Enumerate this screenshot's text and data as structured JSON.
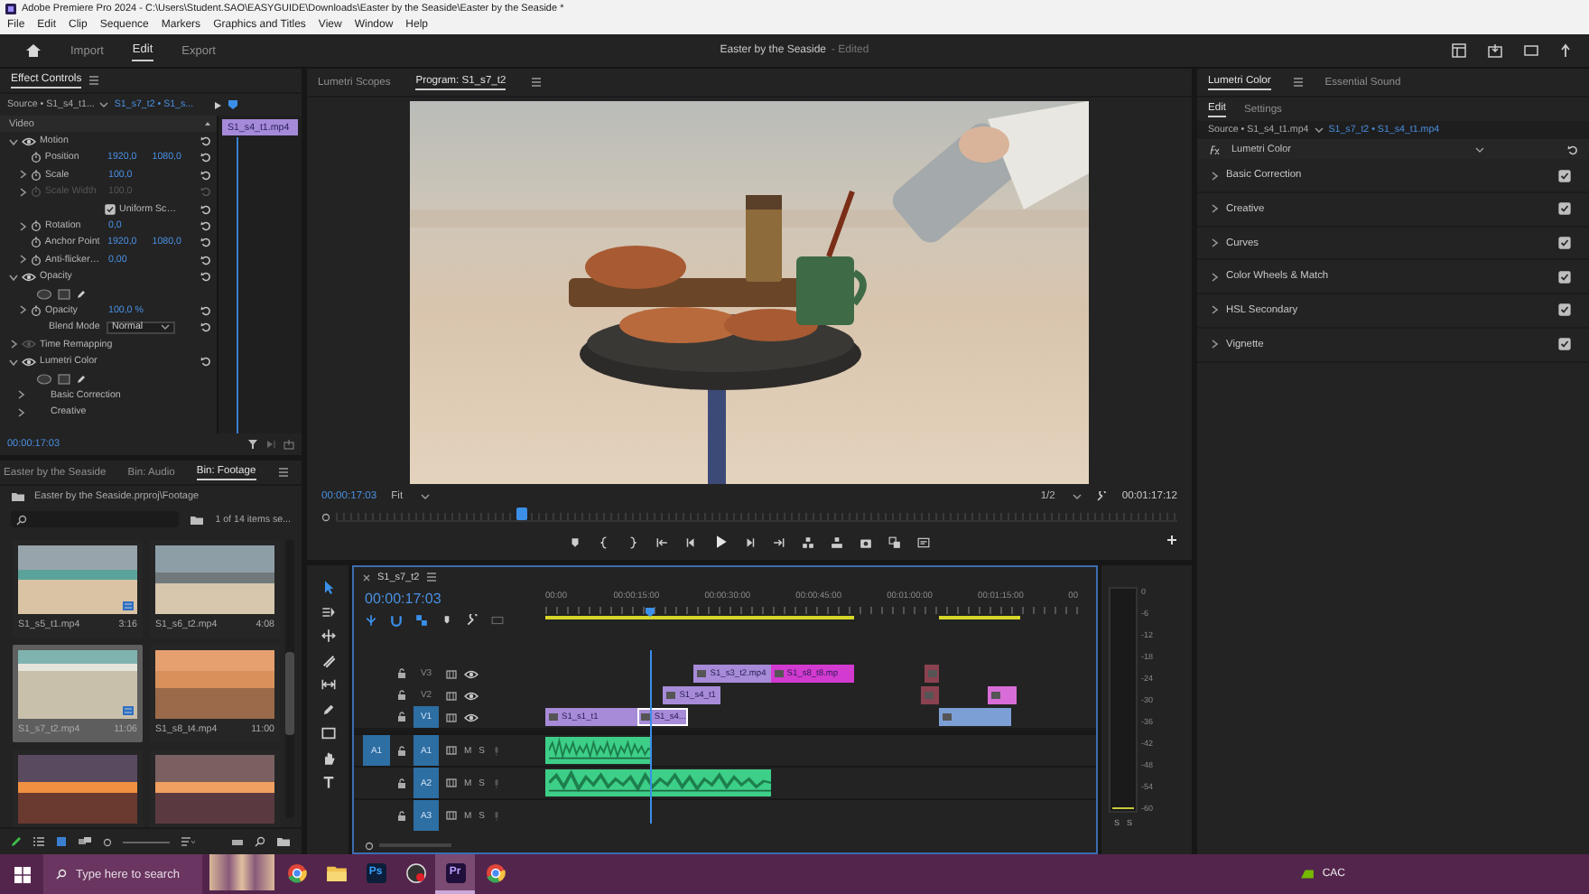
{
  "window": {
    "title": "Adobe Premiere Pro 2024 - C:\\Users\\Student.SAO\\EASYGUIDE\\Downloads\\Easter by the Seaside\\Easter by the Seaside *"
  },
  "menu": [
    "File",
    "Edit",
    "Clip",
    "Sequence",
    "Markers",
    "Graphics and Titles",
    "View",
    "Window",
    "Help"
  ],
  "workspace_tabs": [
    {
      "label": "Import",
      "selected": false
    },
    {
      "label": "Edit",
      "selected": true
    },
    {
      "label": "Export",
      "selected": false
    }
  ],
  "document": {
    "title": "Easter by the Seaside",
    "status": "- Edited"
  },
  "effect_controls": {
    "tab": "Effect Controls",
    "source": "Source • S1_s4_t1...",
    "target": "S1_s7_t2 • S1_s...",
    "clip": "S1_s4_t1.mp4",
    "section": "Video",
    "timecode": "00:00:17:03",
    "rows": [
      {
        "kind": "group",
        "label": "Motion",
        "expanded": true
      },
      {
        "kind": "param",
        "label": "Position",
        "values": [
          "1920,0",
          "1080,0"
        ],
        "expandable": false,
        "disabled": false
      },
      {
        "kind": "param",
        "label": "Scale",
        "values": [
          "100,0"
        ],
        "expandable": true,
        "disabled": false
      },
      {
        "kind": "param",
        "label": "Scale Width",
        "values": [
          "100,0"
        ],
        "expandable": true,
        "disabled": true
      },
      {
        "kind": "check",
        "label": "Uniform Sc…",
        "checked": true
      },
      {
        "kind": "param",
        "label": "Rotation",
        "values": [
          "0,0"
        ],
        "expandable": true,
        "disabled": false
      },
      {
        "kind": "param",
        "label": "Anchor Point",
        "values": [
          "1920,0",
          "1080,0"
        ],
        "expandable": false,
        "disabled": false
      },
      {
        "kind": "param",
        "label": "Anti-flicker…",
        "values": [
          "0,00"
        ],
        "expandable": true,
        "disabled": false
      },
      {
        "kind": "group",
        "label": "Opacity",
        "expanded": true
      },
      {
        "kind": "masks"
      },
      {
        "kind": "param",
        "label": "Opacity",
        "values": [
          "100,0 %"
        ],
        "expandable": true,
        "disabled": false
      },
      {
        "kind": "dropdown",
        "label": "Blend Mode",
        "value": "Normal"
      },
      {
        "kind": "group",
        "label": "Time Remapping",
        "expanded": false
      },
      {
        "kind": "group",
        "label": "Lumetri Color",
        "expanded": true
      },
      {
        "kind": "masks"
      },
      {
        "kind": "sub",
        "label": "Basic Correction"
      },
      {
        "kind": "sub",
        "label": "Creative"
      }
    ]
  },
  "program": {
    "tabs": [
      {
        "label": "Lumetri Scopes",
        "selected": false
      },
      {
        "label": "Program: S1_s7_t2",
        "selected": true
      }
    ],
    "timecode": "00:00:17:03",
    "zoom": "Fit",
    "resolution": "1/2",
    "duration": "00:01:17:12",
    "playhead": {
      "level": 0.22
    }
  },
  "project": {
    "tabs": [
      {
        "label": "Easter by the Seaside",
        "selected": false
      },
      {
        "label": "Bin: Audio",
        "selected": false
      },
      {
        "label": "Bin: Footage",
        "selected": true
      }
    ],
    "path": "Easter by the Seaside.prproj\\Footage",
    "count": "1 of 14 items se...",
    "items": [
      {
        "label": "S1_s5_t1.mp4",
        "duration": "3:16",
        "selected": false,
        "badge": true
      },
      {
        "label": "S1_s6_t2.mp4",
        "duration": "4:08",
        "selected": false,
        "badge": false
      },
      {
        "label": "S1_s7_t2.mp4",
        "duration": "11:06",
        "selected": true,
        "badge": true
      },
      {
        "label": "S1_s8_t4.mp4",
        "duration": "11:00",
        "selected": false,
        "badge": false
      },
      {
        "selected": false,
        "badge": false
      },
      {
        "selected": false,
        "badge": false
      }
    ]
  },
  "timeline": {
    "tab": "S1_s7_t2",
    "timecode": "00:00:17:03",
    "playhead": {
      "level": 0.195
    },
    "ruler": [
      "00:00",
      "00:00:15:00",
      "00:00:30:00",
      "00:00:45:00",
      "00:01:00:00",
      "00:01:15:00",
      "00"
    ],
    "video_tracks": [
      {
        "label": "V3",
        "targeted": false,
        "clips": [
          {
            "label": "S1_s3_t2.mp4",
            "color": "#a78bd8",
            "selected": false
          },
          {
            "label": "S1_s8_t8.mp",
            "color": "#d23ad0",
            "selected": false
          },
          {
            "color": "#8a4250",
            "selected": false
          }
        ]
      },
      {
        "label": "V2",
        "targeted": false,
        "clips": [
          {
            "label": "S1_s4_t1",
            "color": "#a78bd8",
            "selected": false
          },
          {
            "color": "#8a4250",
            "selected": false
          },
          {
            "color": "#d96dd8",
            "selected": false
          }
        ]
      },
      {
        "label": "V1",
        "targeted": true,
        "clips": [
          {
            "label": "S1_s1_t1",
            "color": "#a78bd8",
            "selected": false
          },
          {
            "label": "S1_s4...",
            "color": "#a78bd8",
            "selected": true
          },
          {
            "color": "#7c9fd6",
            "selected": false
          }
        ]
      }
    ],
    "audio_tracks": [
      {
        "label": "A1",
        "source": "A1",
        "targeted": true,
        "mute": "M",
        "solo": "S",
        "clips": [
          {
            "color": "#3dcf88",
            "selected": false
          }
        ]
      },
      {
        "label": "A2",
        "targeted": true,
        "mute": "M",
        "solo": "S",
        "clips": [
          {
            "color": "#3dcf88",
            "selected": false
          }
        ]
      },
      {
        "label": "A3",
        "targeted": true,
        "mute": "M",
        "solo": "S"
      }
    ]
  },
  "meter": {
    "scale": [
      "0",
      "-6",
      "-12",
      "-18",
      "-24",
      "-30",
      "-36",
      "-42",
      "-48",
      "-54",
      "-60"
    ],
    "solo": [
      "S",
      "S"
    ]
  },
  "lumetri": {
    "tabs": [
      {
        "label": "Lumetri Color",
        "selected": true
      },
      {
        "label": "Essential Sound",
        "selected": false
      }
    ],
    "subtabs": [
      {
        "label": "Edit",
        "selected": true
      },
      {
        "label": "Settings",
        "selected": false
      }
    ],
    "source": "Source • S1_s4_t1.mp4",
    "target": "S1_s7_t2 • S1_s4_t1.mp4",
    "effect": "Lumetri Color",
    "sections": [
      {
        "label": "Basic Correction",
        "checked": true
      },
      {
        "label": "Creative",
        "checked": true
      },
      {
        "label": "Curves",
        "checked": true
      },
      {
        "label": "Color Wheels & Match",
        "checked": true
      },
      {
        "label": "HSL Secondary",
        "checked": true
      },
      {
        "label": "Vignette",
        "checked": true
      }
    ]
  },
  "taskbar": {
    "search": {
      "placeholder": "Type here to search"
    },
    "apps": [
      {
        "kind": "photo",
        "selected": false
      },
      {
        "kind": "chrome",
        "selected": false
      },
      {
        "kind": "folder",
        "selected": false
      },
      {
        "kind": "ps",
        "label": "Ps",
        "selected": false
      },
      {
        "kind": "recorder",
        "selected": false
      },
      {
        "kind": "pr",
        "label": "Pr",
        "selected": true
      },
      {
        "kind": "chrome",
        "selected": false
      }
    ],
    "tray": "CAC"
  }
}
